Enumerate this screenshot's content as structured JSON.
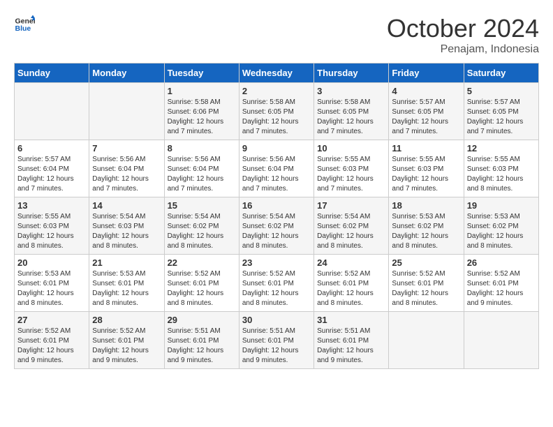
{
  "logo": {
    "line1": "General",
    "line2": "Blue"
  },
  "header": {
    "month": "October 2024",
    "location": "Penajam, Indonesia"
  },
  "days_of_week": [
    "Sunday",
    "Monday",
    "Tuesday",
    "Wednesday",
    "Thursday",
    "Friday",
    "Saturday"
  ],
  "weeks": [
    [
      {
        "day": "",
        "details": ""
      },
      {
        "day": "",
        "details": ""
      },
      {
        "day": "1",
        "details": "Sunrise: 5:58 AM\nSunset: 6:06 PM\nDaylight: 12 hours\nand 7 minutes."
      },
      {
        "day": "2",
        "details": "Sunrise: 5:58 AM\nSunset: 6:05 PM\nDaylight: 12 hours\nand 7 minutes."
      },
      {
        "day": "3",
        "details": "Sunrise: 5:58 AM\nSunset: 6:05 PM\nDaylight: 12 hours\nand 7 minutes."
      },
      {
        "day": "4",
        "details": "Sunrise: 5:57 AM\nSunset: 6:05 PM\nDaylight: 12 hours\nand 7 minutes."
      },
      {
        "day": "5",
        "details": "Sunrise: 5:57 AM\nSunset: 6:05 PM\nDaylight: 12 hours\nand 7 minutes."
      }
    ],
    [
      {
        "day": "6",
        "details": "Sunrise: 5:57 AM\nSunset: 6:04 PM\nDaylight: 12 hours\nand 7 minutes."
      },
      {
        "day": "7",
        "details": "Sunrise: 5:56 AM\nSunset: 6:04 PM\nDaylight: 12 hours\nand 7 minutes."
      },
      {
        "day": "8",
        "details": "Sunrise: 5:56 AM\nSunset: 6:04 PM\nDaylight: 12 hours\nand 7 minutes."
      },
      {
        "day": "9",
        "details": "Sunrise: 5:56 AM\nSunset: 6:04 PM\nDaylight: 12 hours\nand 7 minutes."
      },
      {
        "day": "10",
        "details": "Sunrise: 5:55 AM\nSunset: 6:03 PM\nDaylight: 12 hours\nand 7 minutes."
      },
      {
        "day": "11",
        "details": "Sunrise: 5:55 AM\nSunset: 6:03 PM\nDaylight: 12 hours\nand 7 minutes."
      },
      {
        "day": "12",
        "details": "Sunrise: 5:55 AM\nSunset: 6:03 PM\nDaylight: 12 hours\nand 8 minutes."
      }
    ],
    [
      {
        "day": "13",
        "details": "Sunrise: 5:55 AM\nSunset: 6:03 PM\nDaylight: 12 hours\nand 8 minutes."
      },
      {
        "day": "14",
        "details": "Sunrise: 5:54 AM\nSunset: 6:03 PM\nDaylight: 12 hours\nand 8 minutes."
      },
      {
        "day": "15",
        "details": "Sunrise: 5:54 AM\nSunset: 6:02 PM\nDaylight: 12 hours\nand 8 minutes."
      },
      {
        "day": "16",
        "details": "Sunrise: 5:54 AM\nSunset: 6:02 PM\nDaylight: 12 hours\nand 8 minutes."
      },
      {
        "day": "17",
        "details": "Sunrise: 5:54 AM\nSunset: 6:02 PM\nDaylight: 12 hours\nand 8 minutes."
      },
      {
        "day": "18",
        "details": "Sunrise: 5:53 AM\nSunset: 6:02 PM\nDaylight: 12 hours\nand 8 minutes."
      },
      {
        "day": "19",
        "details": "Sunrise: 5:53 AM\nSunset: 6:02 PM\nDaylight: 12 hours\nand 8 minutes."
      }
    ],
    [
      {
        "day": "20",
        "details": "Sunrise: 5:53 AM\nSunset: 6:01 PM\nDaylight: 12 hours\nand 8 minutes."
      },
      {
        "day": "21",
        "details": "Sunrise: 5:53 AM\nSunset: 6:01 PM\nDaylight: 12 hours\nand 8 minutes."
      },
      {
        "day": "22",
        "details": "Sunrise: 5:52 AM\nSunset: 6:01 PM\nDaylight: 12 hours\nand 8 minutes."
      },
      {
        "day": "23",
        "details": "Sunrise: 5:52 AM\nSunset: 6:01 PM\nDaylight: 12 hours\nand 8 minutes."
      },
      {
        "day": "24",
        "details": "Sunrise: 5:52 AM\nSunset: 6:01 PM\nDaylight: 12 hours\nand 8 minutes."
      },
      {
        "day": "25",
        "details": "Sunrise: 5:52 AM\nSunset: 6:01 PM\nDaylight: 12 hours\nand 8 minutes."
      },
      {
        "day": "26",
        "details": "Sunrise: 5:52 AM\nSunset: 6:01 PM\nDaylight: 12 hours\nand 9 minutes."
      }
    ],
    [
      {
        "day": "27",
        "details": "Sunrise: 5:52 AM\nSunset: 6:01 PM\nDaylight: 12 hours\nand 9 minutes."
      },
      {
        "day": "28",
        "details": "Sunrise: 5:52 AM\nSunset: 6:01 PM\nDaylight: 12 hours\nand 9 minutes."
      },
      {
        "day": "29",
        "details": "Sunrise: 5:51 AM\nSunset: 6:01 PM\nDaylight: 12 hours\nand 9 minutes."
      },
      {
        "day": "30",
        "details": "Sunrise: 5:51 AM\nSunset: 6:01 PM\nDaylight: 12 hours\nand 9 minutes."
      },
      {
        "day": "31",
        "details": "Sunrise: 5:51 AM\nSunset: 6:01 PM\nDaylight: 12 hours\nand 9 minutes."
      },
      {
        "day": "",
        "details": ""
      },
      {
        "day": "",
        "details": ""
      }
    ]
  ]
}
